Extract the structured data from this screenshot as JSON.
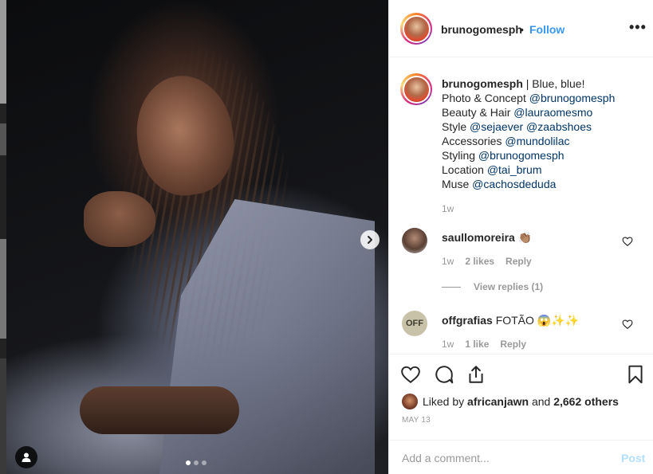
{
  "post": {
    "carousel": {
      "slide_count": 3,
      "active_slide": 1
    }
  },
  "header": {
    "username": "brunogomesph",
    "separator": "•",
    "follow_label": "Follow",
    "more_label": "•••"
  },
  "caption": {
    "username": "brunogomesph",
    "title": "| Blue, blue!",
    "lines": [
      {
        "label": "Photo & Concept",
        "mentions": [
          "@brunogomesph"
        ]
      },
      {
        "label": "Beauty & Hair",
        "mentions": [
          "@lauraomesmo"
        ]
      },
      {
        "label": "Style",
        "mentions": [
          "@sejaever",
          "@zaabshoes"
        ]
      },
      {
        "label": "Accessories",
        "mentions": [
          "@mundolilac"
        ]
      },
      {
        "label": "Styling",
        "mentions": [
          "@brunogomesph"
        ]
      },
      {
        "label": "Location",
        "mentions": [
          "@tai_brum"
        ]
      },
      {
        "label": "Muse",
        "mentions": [
          "@cachosdeduda"
        ]
      }
    ],
    "time": "1w"
  },
  "comments": [
    {
      "username": "saullomoreira",
      "text": "👏🏽",
      "time": "1w",
      "likes": "2 likes",
      "reply_label": "Reply",
      "view_replies": "View replies (1)"
    },
    {
      "username": "offgrafias",
      "text": "FOTÃO 😱✨✨",
      "time": "1w",
      "likes": "1 like",
      "reply_label": "Reply",
      "avatar_text": "OFF"
    }
  ],
  "likes": {
    "prefix": "Liked by",
    "user": "africanjawn",
    "suffix": "and",
    "others": "2,662 others"
  },
  "date": "MAY 13",
  "add_comment": {
    "placeholder": "Add a comment...",
    "post_label": "Post"
  },
  "colors": {
    "accent_blue": "#3897f0",
    "mention": "#003569",
    "muted": "#999999",
    "post_disabled": "#b2dffc"
  }
}
